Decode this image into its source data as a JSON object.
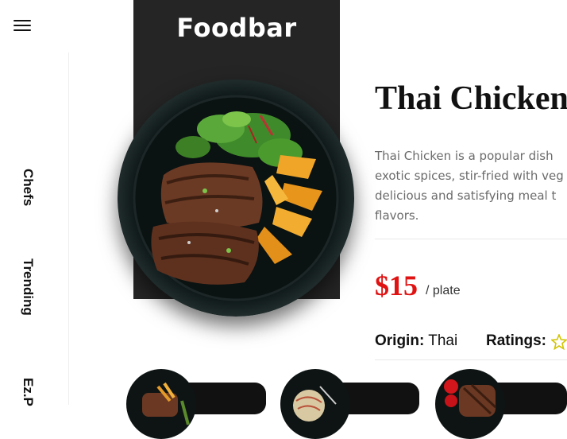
{
  "header": {
    "brand": "Foodbar",
    "menu_icon": "hamburger-icon"
  },
  "sidebar": {
    "items": [
      {
        "label": "Chefs"
      },
      {
        "label": "Trending"
      },
      {
        "label": "Ez.P"
      }
    ]
  },
  "dish": {
    "title": "Thai Chicken",
    "description": "Thai Chicken is a popular dish … exotic spices, stir-fried with veg… delicious and satisfying meal t… flavors.",
    "description_lines": [
      "Thai Chicken is a popular dish",
      "exotic spices, stir-fried with veg",
      "delicious and satisfying meal t",
      "flavors."
    ],
    "price": "$15",
    "price_unit": "/ plate",
    "origin_label": "Origin:",
    "origin_value": "Thai",
    "ratings_label": "Ratings:",
    "rating_icon": "star-icon",
    "accent_color": "#e01212"
  },
  "related": {
    "cards": [
      {
        "name": "steak-fries-thumb"
      },
      {
        "name": "noodles-thumb"
      },
      {
        "name": "steak-tomato-thumb"
      }
    ]
  }
}
